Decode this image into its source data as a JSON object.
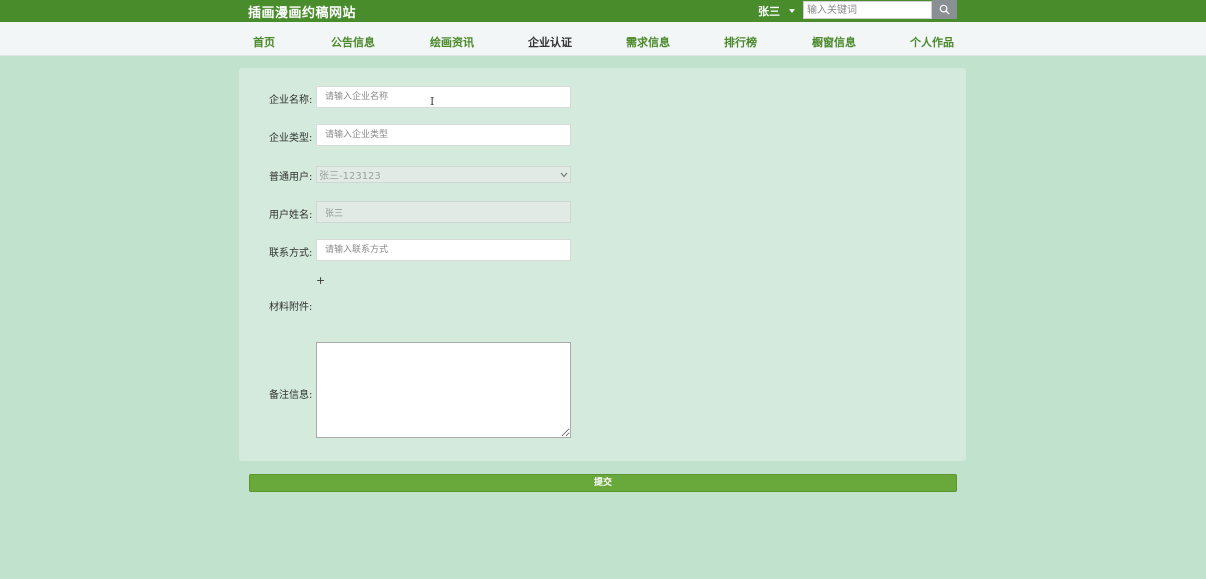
{
  "header": {
    "site_title": "插画漫画约稿网站",
    "user_name": "张三",
    "search_placeholder": "输入关键词",
    "search_icon": "search-icon"
  },
  "nav": {
    "items": [
      {
        "label": "首页"
      },
      {
        "label": "公告信息"
      },
      {
        "label": "绘画资讯"
      },
      {
        "label": "企业认证",
        "active": true
      },
      {
        "label": "需求信息"
      },
      {
        "label": "排行榜"
      },
      {
        "label": "橱窗信息"
      },
      {
        "label": "个人作品"
      }
    ]
  },
  "form": {
    "company_name": {
      "label": "企业名称:",
      "placeholder": "请输入企业名称"
    },
    "company_type": {
      "label": "企业类型:",
      "placeholder": "请输入企业类型"
    },
    "user_select": {
      "label": "普通用户:",
      "value": "张三-123123"
    },
    "user_name": {
      "label": "用户姓名:",
      "value": "张三"
    },
    "contact": {
      "label": "联系方式:",
      "placeholder": "请输入联系方式"
    },
    "attachment": {
      "label": "材料附件:",
      "upload_symbol": "+"
    },
    "remarks": {
      "label": "备注信息:",
      "value": ""
    },
    "submit_label": "提交"
  },
  "colors": {
    "header_bg": "#488c2b",
    "page_bg": "#c1e2cc",
    "panel_bg": "#d3eadc",
    "nav_text": "#4a8a2b",
    "submit_bg": "#69a83a"
  }
}
